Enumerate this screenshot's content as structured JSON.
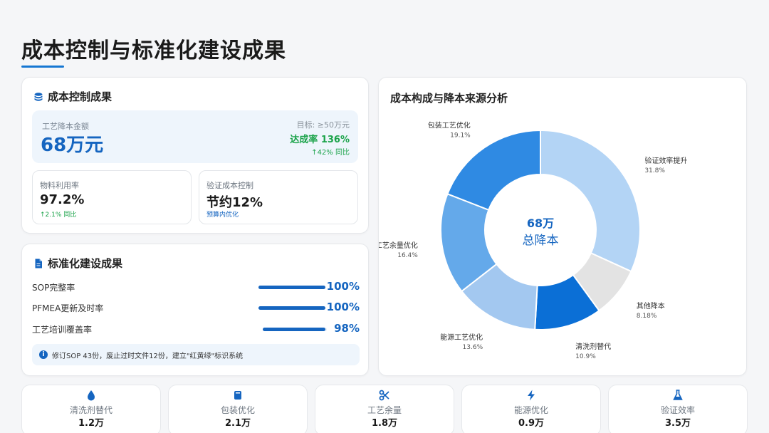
{
  "page": {
    "title": "成本控制与标准化建设成果"
  },
  "cost_card": {
    "title": "成本控制成果",
    "hero": {
      "label": "工艺降本金额",
      "value": "68万元",
      "target": "目标: ≥50万元",
      "rate": "达成率 136%",
      "yoy": "↑42% 同比"
    },
    "metrics": [
      {
        "label": "物料利用率",
        "value": "97.2%",
        "note": "↑2.1% 同比",
        "note_color": "#1ba34a"
      },
      {
        "label": "验证成本控制",
        "value": "节约12%",
        "note": "预算内优化",
        "note_color": "#1565c0"
      }
    ]
  },
  "standard_card": {
    "title": "标准化建设成果",
    "items": [
      {
        "label": "SOP完整率",
        "value": "100%",
        "percent": 100
      },
      {
        "label": "PFMEA更新及时率",
        "value": "100%",
        "percent": 100
      },
      {
        "label": "工艺培训覆盖率",
        "value": "98%",
        "percent": 98
      }
    ],
    "note": "修订SOP 43份，废止过时文件12份，建立\"红黄绿\"标识系统"
  },
  "chart_card": {
    "title": "成本构成与降本来源分析"
  },
  "chart_data": {
    "type": "pie",
    "center_value": "68万",
    "center_label": "总降本",
    "slices": [
      {
        "name": "验证效率提升",
        "value": 31.8,
        "label": "31.8%",
        "color": "#b3d4f5"
      },
      {
        "name": "其他降本",
        "value": 8.18,
        "label": "8.18%",
        "color": "#e3e3e3"
      },
      {
        "name": "清洗剂替代",
        "value": 10.9,
        "label": "10.9%",
        "color": "#0b6fd6"
      },
      {
        "name": "能源工艺优化",
        "value": 13.6,
        "label": "13.6%",
        "color": "#a3c8f0"
      },
      {
        "name": "工艺余量优化",
        "value": 16.4,
        "label": "16.4%",
        "color": "#64a9ea"
      },
      {
        "name": "包装工艺优化",
        "value": 19.1,
        "label": "19.1%",
        "color": "#2f8ae3"
      }
    ]
  },
  "tiles": [
    {
      "label": "清洗剂替代",
      "value": "1.2万",
      "icon": "droplet-icon"
    },
    {
      "label": "包装优化",
      "value": "2.1万",
      "icon": "package-icon"
    },
    {
      "label": "工艺余量",
      "value": "1.8万",
      "icon": "scissors-icon"
    },
    {
      "label": "能源优化",
      "value": "0.9万",
      "icon": "bolt-icon"
    },
    {
      "label": "验证效率",
      "value": "3.5万",
      "icon": "flask-icon"
    }
  ],
  "colors": {
    "accent": "#1565c0",
    "success": "#1ba34a"
  }
}
